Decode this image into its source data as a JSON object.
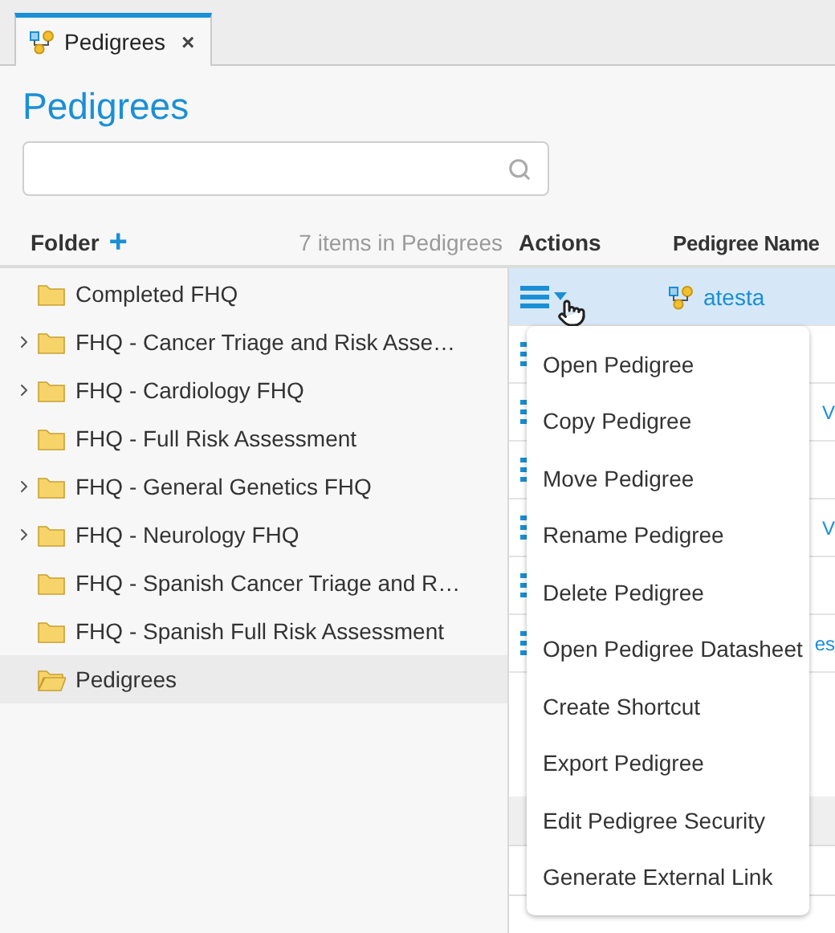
{
  "tabs": [
    {
      "label": "Pedigrees",
      "close": "×",
      "selected": true
    }
  ],
  "title": "Pedigrees",
  "search": {
    "kind": "field"
  },
  "folder_header": {
    "label": "Folder",
    "add": "+",
    "count": "7 items in Pedigrees"
  },
  "folders": [
    {
      "label": "Completed FHQ",
      "has_children": false,
      "selected": false
    },
    {
      "label": "FHQ - Cancer Triage and Risk Asse…",
      "has_children": true,
      "selected": false
    },
    {
      "label": "FHQ - Cardiology FHQ",
      "has_children": true,
      "selected": false
    },
    {
      "label": "FHQ - Full Risk Assessment",
      "has_children": false,
      "selected": false
    },
    {
      "label": "FHQ - General Genetics FHQ",
      "has_children": true,
      "selected": false
    },
    {
      "label": "FHQ - Neurology FHQ",
      "has_children": true,
      "selected": false
    },
    {
      "label": "FHQ - Spanish Cancer Triage and R…",
      "has_children": false,
      "selected": false
    },
    {
      "label": "FHQ - Spanish Full Risk Assessment",
      "has_children": false,
      "selected": false
    },
    {
      "label": "Pedigrees",
      "has_children": false,
      "selected": true
    }
  ],
  "table": {
    "columns": [
      "Actions",
      "Pedigree Name"
    ],
    "rows": [
      {
        "name": "atesta",
        "kind": "full",
        "selected": true
      },
      {
        "name": "",
        "kind": "fragment",
        "selected": false
      },
      {
        "name": "V",
        "kind": "fragment",
        "selected": false
      },
      {
        "name": "",
        "kind": "fragment",
        "selected": false
      },
      {
        "name": "V",
        "kind": "fragment",
        "selected": false
      },
      {
        "name": "",
        "kind": "fragment",
        "selected": false
      },
      {
        "name": "es",
        "kind": "fragment",
        "selected": false
      }
    ]
  },
  "menu": [
    "Open Pedigree",
    "Copy Pedigree",
    "Move Pedigree",
    "Rename Pedigree",
    "Delete Pedigree",
    "Open Pedigree Datasheet",
    "Create Shortcut",
    "Export Pedigree",
    "Edit Pedigree Security",
    "Generate External Link"
  ]
}
